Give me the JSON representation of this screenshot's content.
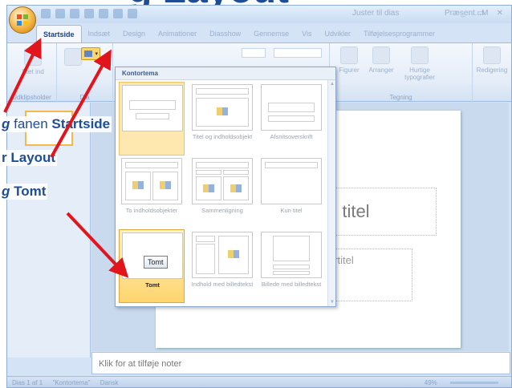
{
  "heading": "g Layout",
  "window": {
    "title_left": "Juster til dias",
    "title_right": "Præsent...M"
  },
  "tabs": [
    "Startside",
    "Indsæt",
    "Design",
    "Animationer",
    "Diasshow",
    "Gennemse",
    "Vis",
    "Udvikler",
    "Tilføjelsesprogrammer"
  ],
  "ribbon": {
    "paste_label": "Sæt ind",
    "clipboard_group": "Udklipsholder",
    "slides_group": "Dia",
    "shapes_label": "Figurer",
    "arrange_label": "Arranger",
    "quick_styles_label": "Hurtige typografier",
    "drawing_group": "Tegning",
    "editing_label": "Redigering"
  },
  "gallery": {
    "header": "Kontortema",
    "layouts": [
      {
        "name": "Titeldias"
      },
      {
        "name": "Titel og indholdsobjekt"
      },
      {
        "name": "Afsnitsoverskrift"
      },
      {
        "name": "To indholdsobjekter"
      },
      {
        "name": "Sammenligning"
      },
      {
        "name": "Kun titel"
      },
      {
        "name": "Tomt"
      },
      {
        "name": "Indhold med billedtekst"
      },
      {
        "name": "Billede med billedtekst"
      }
    ],
    "tooltip": "Tomt"
  },
  "slide": {
    "title_placeholder": "e en titel",
    "subtitle_placeholder": "undertitel"
  },
  "notes_placeholder": "Klik for at tilføje noter",
  "status": {
    "slide_count": "Dias 1 af 1",
    "theme": "\"Kontortema\"",
    "language": "Dansk",
    "zoom": "49%"
  },
  "callouts": {
    "step1_prefix": "g",
    "step1_mid": " fanen ",
    "step1_target": "Startside",
    "step2_prefix": "r",
    "step2_target": "Layout",
    "step3_prefix": "g",
    "step3_target": "Tomt"
  },
  "colors": {
    "accent": "#1f4e96",
    "arrow": "#e0161c",
    "highlight": "#ffd46e"
  }
}
